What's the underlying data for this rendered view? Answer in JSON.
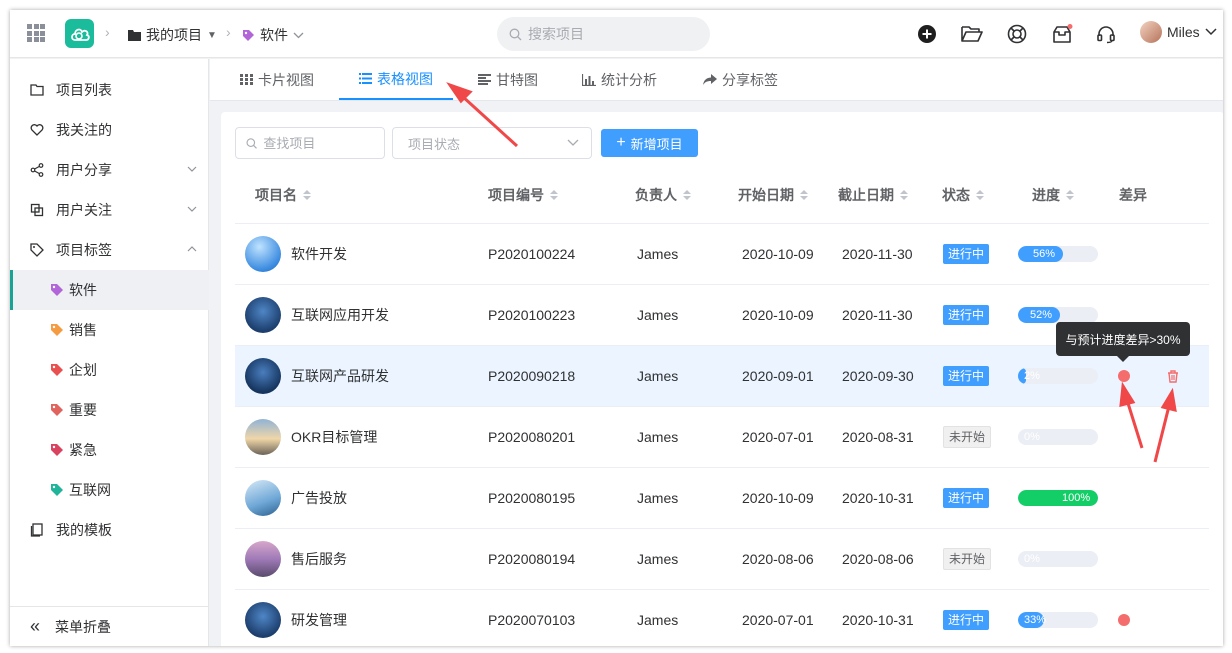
{
  "header": {
    "breadcrumb": [
      "我的项目",
      "软件"
    ],
    "search_placeholder": "搜索项目",
    "user_name": "Miles",
    "icons": [
      "grid-icon",
      "cloud-logo",
      "folder-icon",
      "tag-icon",
      "chevron-down-icon",
      "add-icon",
      "folder-open-icon",
      "help-ring-icon",
      "inbox-icon",
      "headset-icon"
    ]
  },
  "sidebar": {
    "items": [
      {
        "label": "项目列表",
        "icon": "folder-icon"
      },
      {
        "label": "我关注的",
        "icon": "heart-icon"
      },
      {
        "label": "用户分享",
        "icon": "share-icon"
      },
      {
        "label": "用户关注",
        "icon": "copy-icon"
      },
      {
        "label": "项目标签",
        "icon": "tag-icon"
      }
    ],
    "tags": [
      {
        "label": "软件",
        "color": "#b265d8"
      },
      {
        "label": "销售",
        "color": "#f59b42"
      },
      {
        "label": "企划",
        "color": "#e8514f"
      },
      {
        "label": "重要",
        "color": "#e0635d"
      },
      {
        "label": "紧急",
        "color": "#d9435f"
      },
      {
        "label": "互联网",
        "color": "#20b49a"
      }
    ],
    "templates": "我的模板",
    "collapse": "菜单折叠"
  },
  "tabs": [
    "卡片视图",
    "表格视图",
    "甘特图",
    "统计分析",
    "分享标签"
  ],
  "active_tab": "表格视图",
  "toolbar": {
    "search_placeholder": "查找项目",
    "status_placeholder": "项目状态",
    "new_button": "新增项目"
  },
  "table": {
    "columns": [
      "项目名",
      "项目编号",
      "负责人",
      "开始日期",
      "截止日期",
      "状态",
      "进度",
      "差异"
    ],
    "rows": [
      {
        "name": "软件开发",
        "code": "P2020100224",
        "owner": "James",
        "start": "2020-10-09",
        "end": "2020-11-30",
        "status": "进行中",
        "progress": 56,
        "progress_label": "56%",
        "diff": false
      },
      {
        "name": "互联网应用开发",
        "code": "P2020100223",
        "owner": "James",
        "start": "2020-10-09",
        "end": "2020-11-30",
        "status": "进行中",
        "progress": 52,
        "progress_label": "52%",
        "diff": false
      },
      {
        "name": "互联网产品研发",
        "code": "P2020090218",
        "owner": "James",
        "start": "2020-09-01",
        "end": "2020-09-30",
        "status": "进行中",
        "progress": 2,
        "progress_label": "2%",
        "diff": true
      },
      {
        "name": "OKR目标管理",
        "code": "P2020080201",
        "owner": "James",
        "start": "2020-07-01",
        "end": "2020-08-31",
        "status": "未开始",
        "progress": 0,
        "progress_label": "0%",
        "diff": false
      },
      {
        "name": "广告投放",
        "code": "P2020080195",
        "owner": "James",
        "start": "2020-10-09",
        "end": "2020-10-31",
        "status": "进行中",
        "progress": 100,
        "progress_label": "100%",
        "diff": false
      },
      {
        "name": "售后服务",
        "code": "P2020080194",
        "owner": "James",
        "start": "2020-08-06",
        "end": "2020-08-06",
        "status": "未开始",
        "progress": 0,
        "progress_label": "0%",
        "diff": false
      },
      {
        "name": "研发管理",
        "code": "P2020070103",
        "owner": "James",
        "start": "2020-07-01",
        "end": "2020-10-31",
        "status": "进行中",
        "progress": 33,
        "progress_label": "33%",
        "diff": true
      }
    ]
  },
  "tooltip": "与预计进度差异>30%",
  "colors": {
    "accent": "#1890ff",
    "primary": "#409eff",
    "success": "#13ce66",
    "danger": "#f56c6c",
    "teal": "#1abc9c"
  }
}
